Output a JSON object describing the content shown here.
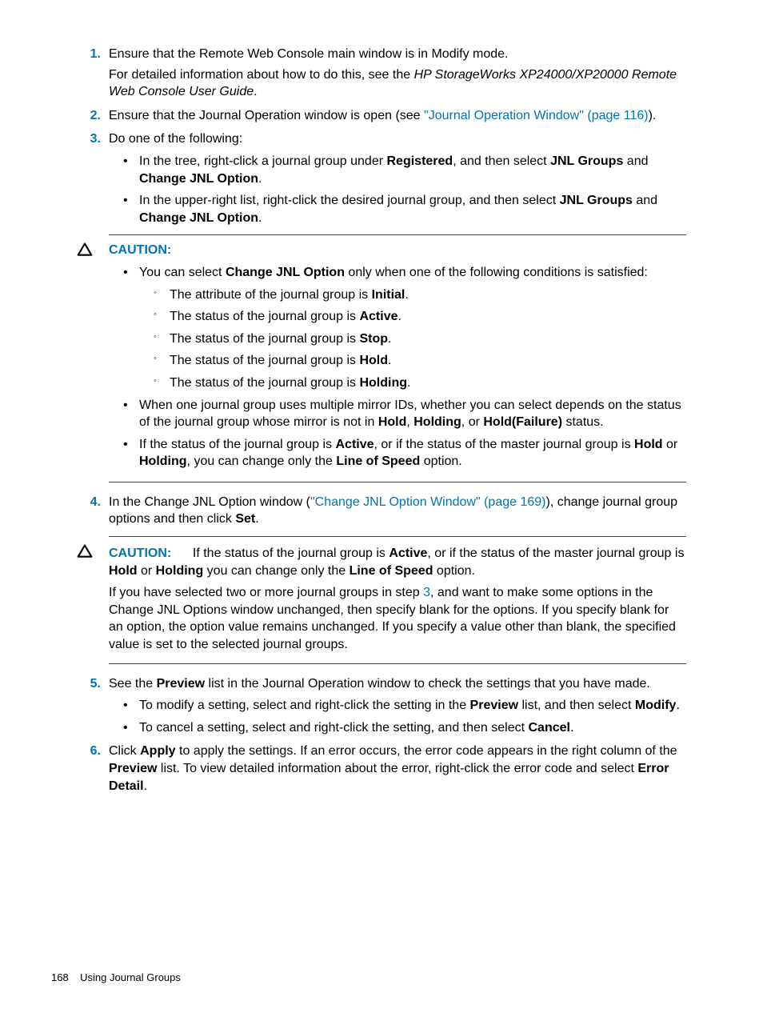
{
  "steps": {
    "1": {
      "num": "1.",
      "text_a": "Ensure that the Remote Web Console main window is in Modify mode.",
      "text_b_prefix": "For detailed information about how to do this, see the ",
      "text_b_italic": "HP StorageWorks XP24000/XP20000 Remote Web Console User Guide",
      "text_b_suffix": "."
    },
    "2": {
      "num": "2.",
      "text_prefix": "Ensure that the Journal Operation window is open (see ",
      "link": "\"Journal Operation Window\" (page 116)",
      "text_suffix": ")."
    },
    "3": {
      "num": "3.",
      "text": "Do one of the following:",
      "bullets": [
        {
          "pre": "In the tree, right-click a journal group under ",
          "b1": "Registered",
          "mid1": ", and then select ",
          "b2": "JNL Groups",
          "mid2": " and ",
          "b3": "Change JNL Option",
          "post": "."
        },
        {
          "pre": "In the upper-right list, right-click the desired journal group, and then select ",
          "b1": "JNL Groups",
          "mid1": " and ",
          "b2": "Change JNL Option",
          "post": "."
        }
      ]
    },
    "4": {
      "num": "4.",
      "text_prefix": "In the Change JNL Option window (",
      "link": "\"Change JNL Option Window\" (page 169)",
      "text_mid": "), change journal group options and then click ",
      "b1": "Set",
      "text_suffix": "."
    },
    "5": {
      "num": "5.",
      "text_prefix": "See the ",
      "b1": "Preview",
      "text_suffix": " list in the Journal Operation window to check the settings that you have made.",
      "bullets": [
        {
          "pre": "To modify a setting, select and right-click the setting in the ",
          "b1": "Preview",
          "mid1": " list, and then select ",
          "b2": "Modify",
          "post": "."
        },
        {
          "pre": "To cancel a setting, select and right-click the setting, and then select ",
          "b1": "Cancel",
          "post": "."
        }
      ]
    },
    "6": {
      "num": "6.",
      "pre": "Click ",
      "b1": "Apply",
      "mid1": " to apply the settings. If an error occurs, the error code appears in the right column of the ",
      "b2": "Preview",
      "mid2": " list. To view detailed information about the error, right-click the error code and select ",
      "b3": "Error Detail",
      "post": "."
    }
  },
  "caution1": {
    "label": "CAUTION:",
    "b1_pre": "You can select ",
    "b1_bold": "Change JNL Option",
    "b1_post": " only when one of the following conditions is satisfied:",
    "sub": [
      {
        "pre": "The attribute of the journal group is ",
        "bold": "Initial",
        "post": "."
      },
      {
        "pre": "The status of the journal group is ",
        "bold": "Active",
        "post": "."
      },
      {
        "pre": "The status of the journal group is ",
        "bold": "Stop",
        "post": "."
      },
      {
        "pre": "The status of the journal group is ",
        "bold": "Hold",
        "post": "."
      },
      {
        "pre": "The status of the journal group is ",
        "bold": "Holding",
        "post": "."
      }
    ],
    "b2_pre": "When one journal group uses multiple mirror IDs, whether you can select depends on the status of the journal group whose mirror is not in ",
    "b2_bold1": "Hold",
    "b2_mid1": ", ",
    "b2_bold2": "Holding",
    "b2_mid2": ", or ",
    "b2_bold3": "Hold(Failure)",
    "b2_post": " status.",
    "b3_pre": "If the status of the journal group is ",
    "b3_bold1": "Active",
    "b3_mid1": ", or if the status of the master journal group is ",
    "b3_bold2": "Hold",
    "b3_mid2": " or ",
    "b3_bold3": "Holding",
    "b3_mid3": ", you can change only the ",
    "b3_bold4": "Line of Speed",
    "b3_post": " option."
  },
  "caution2": {
    "label": "CAUTION:",
    "l1_pre": "If the status of the journal group is ",
    "l1_b1": "Active",
    "l1_mid1": ", or if the status of the master journal group is ",
    "l1_b2": "Hold",
    "l1_mid2": " or ",
    "l1_b3": "Holding",
    "l1_mid3": " you can change only the ",
    "l1_b4": "Line of Speed",
    "l1_post": " option.",
    "l2_pre": "If you have selected two or more journal groups in step ",
    "l2_link": "3",
    "l2_post": ", and want to make some options in the Change JNL Options window unchanged, then specify blank for the options. If you specify blank for an option, the option value remains unchanged. If you specify a value other than blank, the specified value is set to the selected journal groups."
  },
  "footer": {
    "page_num": "168",
    "section": "Using Journal Groups"
  }
}
